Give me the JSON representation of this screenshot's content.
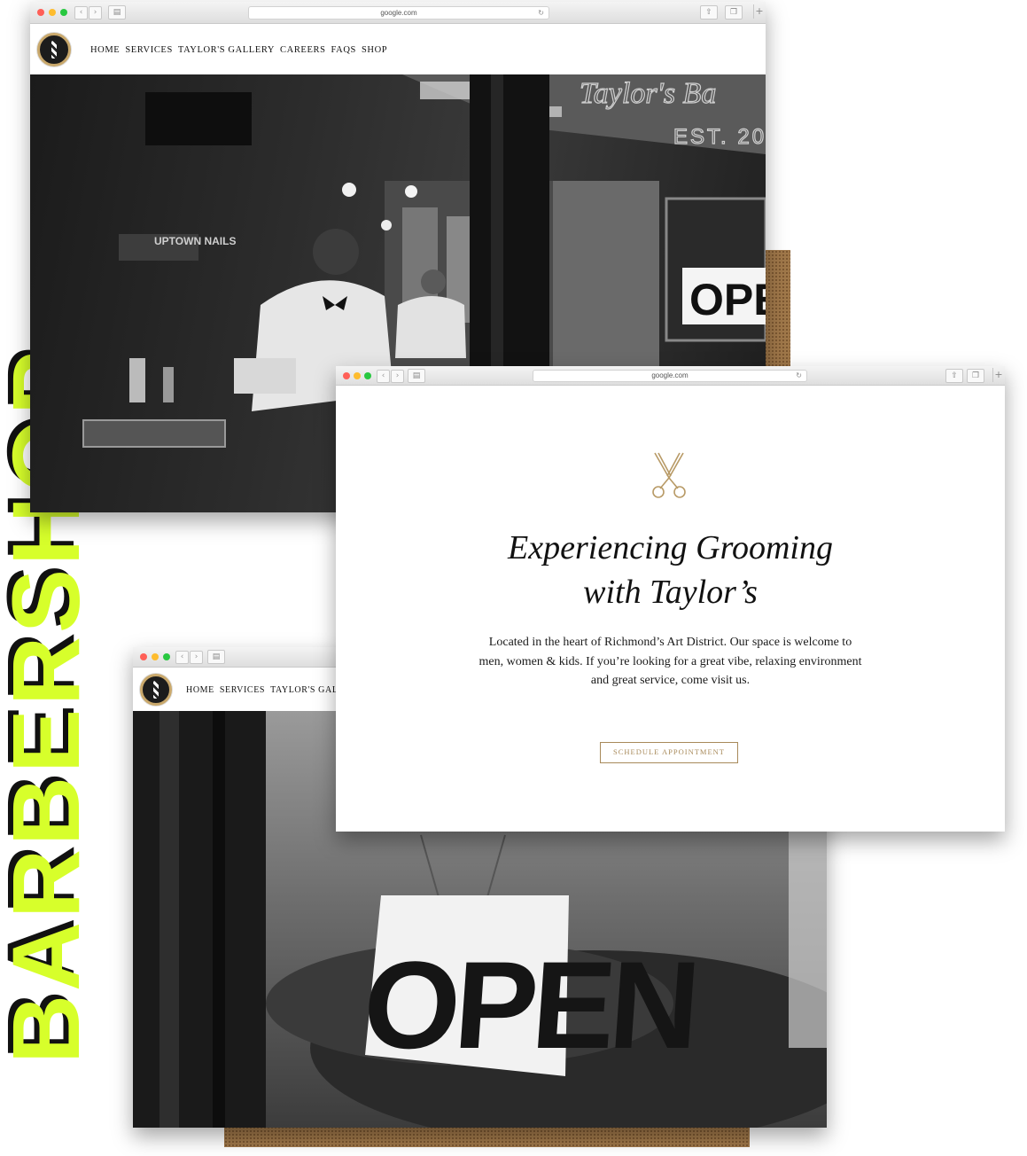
{
  "brand_word": "BARBERSHOP",
  "colors": {
    "accent_lime": "#d7ff2b",
    "gold": "#a88a5a",
    "dark": "#111111"
  },
  "browser": {
    "url": "google.com",
    "back_icon": "chevron-left-icon",
    "forward_icon": "chevron-right-icon",
    "sidebar_icon": "sidebar-icon",
    "reload_icon": "reload-icon",
    "share_icon": "share-icon",
    "tabs_icon": "tabs-icon",
    "new_tab_icon": "plus-icon"
  },
  "site": {
    "nav": [
      "HOME",
      "SERVICES",
      "TAYLOR'S GALLERY",
      "CAREERS",
      "FAQS",
      "SHOP"
    ],
    "nav_partial": [
      "HOME",
      "SERVICES",
      "TAYLOR'S GALLER"
    ]
  },
  "window1": {
    "storefront_script": "Taylor's Ba",
    "storefront_est": "EST. 20",
    "sign": "OPE",
    "shop_sign": "UPTOWN NAILS"
  },
  "window2": {
    "icon": "scissors-icon",
    "heading_line1": "Experiencing Grooming",
    "heading_line2": "with Taylor’s",
    "body_line1": "Located in the heart of Richmond’s Art District.  Our space is welcome to",
    "body_line2": "men, women & kids.  If you’re looking for a great vibe, relaxing environment",
    "body_line3": "and great service, come visit us.",
    "cta": "SCHEDULE APPOINTMENT"
  },
  "window3": {
    "sign": "OPEN"
  }
}
